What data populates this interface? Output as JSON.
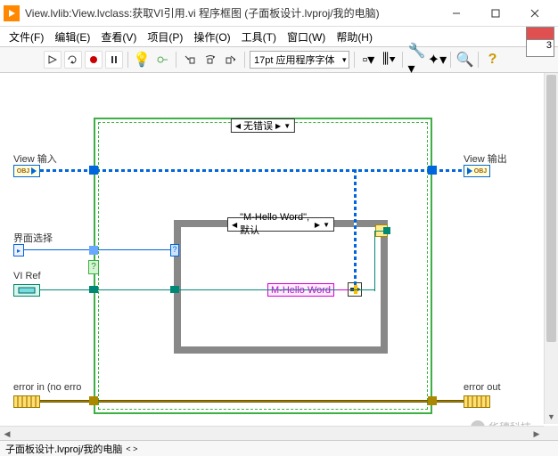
{
  "window": {
    "title": "View.lvlib:View.lvclass:获取VI引用.vi 程序框图  (子面板设计.lvproj/我的电脑)"
  },
  "menu": {
    "file": "文件(F)",
    "edit": "编辑(E)",
    "view": "查看(V)",
    "project": "项目(P)",
    "operate": "操作(O)",
    "tools": "工具(T)",
    "window": "窗口(W)",
    "help": "帮助(H)"
  },
  "toolbar": {
    "font": "17pt 应用程序字体"
  },
  "conn_num": "3",
  "struct": {
    "outer_case": "无错误",
    "inner_case": "\"M-Hello Word\", 默认"
  },
  "labels": {
    "view_in": "View 输入",
    "view_out": "View 输出",
    "page_sel": "界面选择",
    "vi_ref": "VI Ref",
    "err_in": "error in (no erro",
    "err_out": "error out",
    "obj": "OBJ"
  },
  "const": {
    "hello": "M-Hello Word"
  },
  "status": {
    "path": "子面板设计.lvproj/我的电脑"
  },
  "watermark": "华穗科技"
}
